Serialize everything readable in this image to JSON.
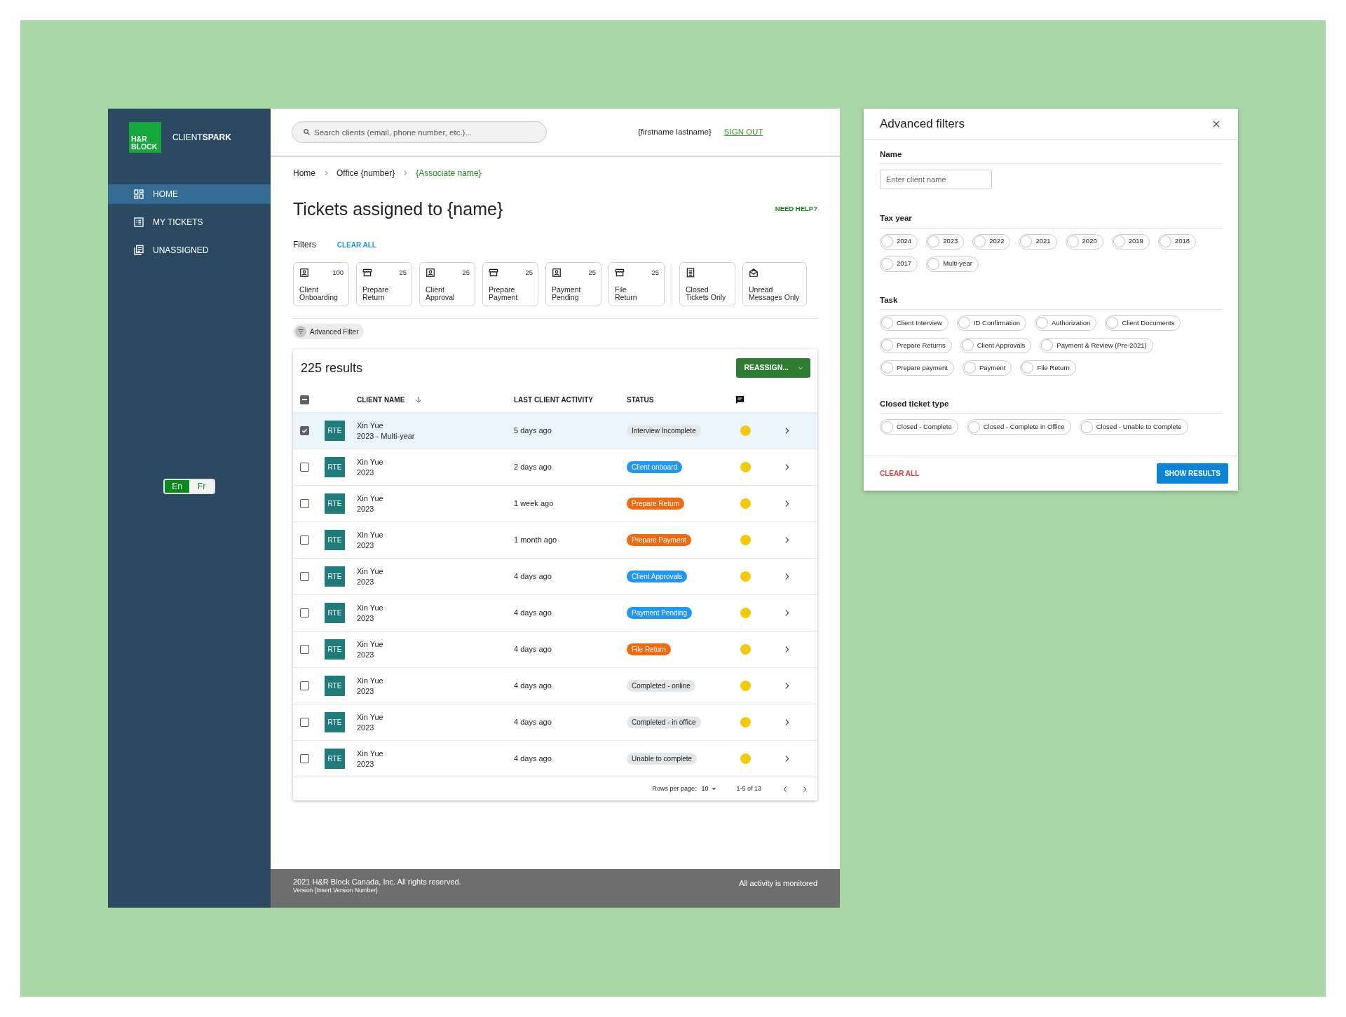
{
  "brand": {
    "logo_lines": [
      "H&R",
      "BLOCK"
    ],
    "app_name": "CLIENT**SPARK**"
  },
  "nav": [
    {
      "label": "HOME",
      "selected": true
    },
    {
      "label": "MY TICKETS",
      "selected": false
    },
    {
      "label": "UNASSIGNED",
      "selected": false
    }
  ],
  "language": [
    {
      "label": "En",
      "selected": true
    },
    {
      "label": "Fr",
      "selected": false
    }
  ],
  "header": {
    "search_placeholder": "Search clients (email, phone number, etc.)...",
    "user_name": "{firstname lastname}",
    "sign_out": "SIGN OUT"
  },
  "breadcrumb": [
    {
      "label": "Home",
      "current": false
    },
    {
      "label": "Office {number}",
      "current": false
    },
    {
      "label": "{Associate name}",
      "current": true
    }
  ],
  "title": "Tickets assigned to {name}",
  "need_help": "NEED HELP?",
  "filters": {
    "label": "Filters",
    "clear_all": "CLEAR ALL",
    "cards": [
      {
        "label_lines": [
          "Client",
          "Onboarding"
        ],
        "count": "100"
      },
      {
        "label_lines": [
          "Prepare",
          "Return"
        ],
        "count": "25"
      },
      {
        "label_lines": [
          "Client",
          "Approval"
        ],
        "count": "25"
      },
      {
        "label_lines": [
          "Prepare",
          "Payment"
        ],
        "count": "25"
      },
      {
        "label_lines": [
          "Payment",
          "Pending"
        ],
        "count": "25"
      },
      {
        "label_lines": [
          "File",
          "Return"
        ],
        "count": "25"
      },
      {
        "label_lines": [
          "Closed",
          "Tickets Only"
        ]
      },
      {
        "label_lines": [
          "Unread",
          "Messages Only"
        ]
      }
    ]
  },
  "advanced_filter": "Advanced Filter",
  "results": {
    "count": "225 results",
    "reassign": "REASSIGN..."
  },
  "table": {
    "select_all_indeterminate": true,
    "columns": [
      {
        "label": "CLIENT NAME",
        "sorted": true
      },
      {
        "label": "LAST CLIENT ACTIVITY",
        "sorted": false
      },
      {
        "label": "STATUS",
        "sorted": false
      }
    ],
    "rows": [
      {
        "checked": true,
        "selected": true,
        "badge": "RTE",
        "name": "Xin Yue",
        "year": "2023 - Multi-year",
        "activity": "5 days ago",
        "status": "Interview Incomplete",
        "color": "#e4e7ea"
      },
      {
        "checked": false,
        "selected": false,
        "badge": "RTE",
        "name": "Xin Yue",
        "year": "2023",
        "activity": "2 days ago",
        "status": "Client onboard",
        "color": "#2196f3"
      },
      {
        "checked": false,
        "selected": false,
        "badge": "RTE",
        "name": "Xin Yue",
        "year": "2023",
        "activity": "1 week ago",
        "status": "Prepare Return",
        "color": "#f26a0f"
      },
      {
        "checked": false,
        "selected": false,
        "badge": "RTE",
        "name": "Xin Yue",
        "year": "2023",
        "activity": "1 month ago",
        "status": "Prepare Payment",
        "color": "#f26a0f"
      },
      {
        "checked": false,
        "selected": false,
        "badge": "RTE",
        "name": "Xin Yue",
        "year": "2023",
        "activity": "4 days ago",
        "status": "Client Approvals",
        "color": "#2196f3"
      },
      {
        "checked": false,
        "selected": false,
        "badge": "RTE",
        "name": "Xin Yue",
        "year": "2023",
        "activity": "4 days ago",
        "status": "Payment Pending",
        "color": "#2196f3"
      },
      {
        "checked": false,
        "selected": false,
        "badge": "RTE",
        "name": "Xin Yue",
        "year": "2023",
        "activity": "4 days ago",
        "status": "File Return",
        "color": "#f26a0f"
      },
      {
        "checked": false,
        "selected": false,
        "badge": "RTE",
        "name": "Xin Yue",
        "year": "2023",
        "activity": "4 days ago",
        "status": "Completed - online",
        "color": "#e4e7ea"
      },
      {
        "checked": false,
        "selected": false,
        "badge": "RTE",
        "name": "Xin Yue",
        "year": "2023",
        "activity": "4 days ago",
        "status": "Completed - in office",
        "color": "#e4e7ea"
      },
      {
        "checked": false,
        "selected": false,
        "badge": "RTE",
        "name": "Xin Yue",
        "year": "2023",
        "activity": "4 days ago",
        "status": "Unable to complete",
        "color": "#e4e7ea"
      }
    ]
  },
  "pagination": {
    "rows_per_page_label": "Rows per page:",
    "rows_per_page": "10",
    "range": "1-5 of 13"
  },
  "footer": {
    "copyright": "2021 H&R Block Canada, Inc. All rights reserved.",
    "version": "Version {Insert Version Number}",
    "notice": "All activity is monitored"
  },
  "panel": {
    "title": "Advanced filters",
    "name_label": "Name",
    "name_placeholder": "Enter client name",
    "groups": [
      {
        "title": "Tax year",
        "options": [
          {
            "label": "2024",
            "checked": false
          },
          {
            "label": "2023",
            "checked": false
          },
          {
            "label": "2022",
            "checked": false
          },
          {
            "label": "2021",
            "checked": false
          },
          {
            "label": "2020",
            "checked": false
          },
          {
            "label": "2019",
            "checked": false
          },
          {
            "label": "2018",
            "checked": false
          },
          {
            "label": "2017",
            "checked": false
          },
          {
            "label": "Multi-year",
            "checked": false
          }
        ]
      },
      {
        "title": "Task",
        "options": [
          {
            "label": "Client Interview",
            "checked": false
          },
          {
            "label": "ID Confirmation",
            "checked": false
          },
          {
            "label": "Authorization",
            "checked": false
          },
          {
            "label": "Client Documents",
            "checked": false
          },
          {
            "label": "Prepare Returns",
            "checked": false
          },
          {
            "label": "Client Approvals",
            "checked": false
          },
          {
            "label": "Payment & Review (Pre-2021)",
            "checked": false
          },
          {
            "label": "Prepare payment",
            "checked": false
          },
          {
            "label": "Payment",
            "checked": false
          },
          {
            "label": "File Return",
            "checked": false
          }
        ]
      },
      {
        "title": "Closed ticket type",
        "options": [
          {
            "label": "Closed - Complete",
            "checked": false
          },
          {
            "label": "Closed - Complete in Office",
            "checked": false
          },
          {
            "label": "Closed - Unable to Complete",
            "checked": false
          }
        ]
      }
    ],
    "clear_all": "CLEAR ALL",
    "show_results": "SHOW RESULTS"
  }
}
